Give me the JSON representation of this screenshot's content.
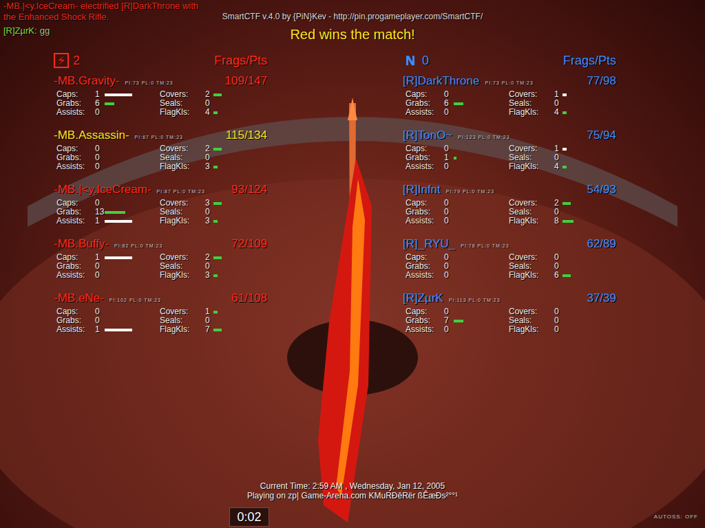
{
  "hud": {
    "killfeed": [
      "-MB.|<y.IceCream- electrified [R]DarkThrone with",
      "the Enhanced Shock Rifle."
    ],
    "chat": {
      "name": "[R]ZµrK:",
      "text": "gg"
    },
    "header": "SmartCTF v.4.0 by {PiN}Kev - http://pin.progameplayer.com/SmartCTF/",
    "banner": "Red wins the match!",
    "clock": "Current Time: 2:59 AM , Wednesday, Jan 12, 2005",
    "server": "Playing on zp| Game-Arena.com KMuRĐêRër ßÊæĐs²°°¹",
    "timer": "0:02",
    "autoss": "AUTOSS: OFF"
  },
  "stat_labels": [
    "Caps:",
    "Grabs:",
    "Assists:",
    "Covers:",
    "Seals:",
    "FlagKls:"
  ],
  "teams": [
    {
      "team": "red",
      "score": "2",
      "column_header": "Frags/Pts",
      "color": "#ff2a1e",
      "players": [
        {
          "name": "-MB.Gravity-",
          "info": "PI:73 PL:0 TM:23",
          "score": "109/147",
          "highlighted": false,
          "stats": [
            {
              "value": "1",
              "level": 1.0,
              "color": "#ffffff"
            },
            {
              "value": "6",
              "level": 0.35,
              "color": "#40d040"
            },
            {
              "value": "0",
              "level": 0,
              "color": "#ffffff"
            },
            {
              "value": "2",
              "level": 0.3,
              "color": "#40d040"
            },
            {
              "value": "0",
              "level": 0,
              "color": "#40d040"
            },
            {
              "value": "4",
              "level": 0.15,
              "color": "#40d040"
            }
          ]
        },
        {
          "name": "-MB.Assassin-",
          "info": "PI:67 PL:0 TM:23",
          "score": "115/134",
          "highlighted": true,
          "stats": [
            {
              "value": "0",
              "level": 0,
              "color": "#ffffff"
            },
            {
              "value": "0",
              "level": 0,
              "color": "#40d040"
            },
            {
              "value": "0",
              "level": 0,
              "color": "#ffffff"
            },
            {
              "value": "2",
              "level": 0.3,
              "color": "#40d040"
            },
            {
              "value": "0",
              "level": 0,
              "color": "#40d040"
            },
            {
              "value": "3",
              "level": 0.15,
              "color": "#40d040"
            }
          ]
        },
        {
          "name": "-MB.|<y.IceCream-",
          "info": "PI:87 PL:0 TM:23",
          "score": "93/124",
          "highlighted": false,
          "stats": [
            {
              "value": "0",
              "level": 0,
              "color": "#ffffff"
            },
            {
              "value": "13",
              "level": 0.75,
              "color": "#40d040"
            },
            {
              "value": "1",
              "level": 1.0,
              "color": "#ffffff"
            },
            {
              "value": "3",
              "level": 0.3,
              "color": "#40d040"
            },
            {
              "value": "0",
              "level": 0,
              "color": "#40d040"
            },
            {
              "value": "3",
              "level": 0.15,
              "color": "#40d040"
            }
          ]
        },
        {
          "name": "-MB.Buffy-",
          "info": "PI:82 PL:0 TM:23",
          "score": "72/109",
          "highlighted": false,
          "stats": [
            {
              "value": "1",
              "level": 1.0,
              "color": "#ffffff"
            },
            {
              "value": "0",
              "level": 0,
              "color": "#40d040"
            },
            {
              "value": "0",
              "level": 0,
              "color": "#ffffff"
            },
            {
              "value": "2",
              "level": 0.3,
              "color": "#40d040"
            },
            {
              "value": "0",
              "level": 0,
              "color": "#40d040"
            },
            {
              "value": "3",
              "level": 0.15,
              "color": "#40d040"
            }
          ]
        },
        {
          "name": "-MB.eNe-",
          "info": "PI:102 PL:0 TM:23",
          "score": "61/108",
          "highlighted": false,
          "stats": [
            {
              "value": "0",
              "level": 0,
              "color": "#ffffff"
            },
            {
              "value": "0",
              "level": 0,
              "color": "#40d040"
            },
            {
              "value": "1",
              "level": 1.0,
              "color": "#ffffff"
            },
            {
              "value": "1",
              "level": 0.15,
              "color": "#40d040"
            },
            {
              "value": "0",
              "level": 0,
              "color": "#40d040"
            },
            {
              "value": "7",
              "level": 0.3,
              "color": "#40d040"
            }
          ]
        }
      ]
    },
    {
      "team": "blue",
      "score": "0",
      "column_header": "Frags/Pts",
      "color": "#3a8cff",
      "players": [
        {
          "name": "[R]DarkThrone",
          "info": "PI:73 PL:0 TM:23",
          "score": "77/98",
          "highlighted": false,
          "stats": [
            {
              "value": "0",
              "level": 0,
              "color": "#ffffff"
            },
            {
              "value": "6",
              "level": 0.35,
              "color": "#40d040"
            },
            {
              "value": "0",
              "level": 0,
              "color": "#ffffff"
            },
            {
              "value": "1",
              "level": 0.15,
              "color": "#ffffff"
            },
            {
              "value": "0",
              "level": 0,
              "color": "#40d040"
            },
            {
              "value": "4",
              "level": 0.15,
              "color": "#40d040"
            }
          ]
        },
        {
          "name": "[R]TonO~",
          "info": "PI:123 PL:0 TM:23",
          "score": "75/94",
          "highlighted": false,
          "stats": [
            {
              "value": "0",
              "level": 0,
              "color": "#ffffff"
            },
            {
              "value": "1",
              "level": 0.1,
              "color": "#40d040"
            },
            {
              "value": "0",
              "level": 0,
              "color": "#ffffff"
            },
            {
              "value": "1",
              "level": 0.15,
              "color": "#ffffff"
            },
            {
              "value": "0",
              "level": 0,
              "color": "#40d040"
            },
            {
              "value": "4",
              "level": 0.15,
              "color": "#40d040"
            }
          ]
        },
        {
          "name": "[R]Infnt",
          "info": "PI:79 PL:0 TM:23",
          "score": "54/93",
          "highlighted": false,
          "stats": [
            {
              "value": "0",
              "level": 0,
              "color": "#ffffff"
            },
            {
              "value": "0",
              "level": 0,
              "color": "#40d040"
            },
            {
              "value": "0",
              "level": 0,
              "color": "#ffffff"
            },
            {
              "value": "2",
              "level": 0.3,
              "color": "#40d040"
            },
            {
              "value": "0",
              "level": 0,
              "color": "#40d040"
            },
            {
              "value": "8",
              "level": 0.4,
              "color": "#40d040"
            }
          ]
        },
        {
          "name": "[R]_RYU_",
          "info": "PI:78 PL:0 TM:23",
          "score": "62/89",
          "highlighted": false,
          "stats": [
            {
              "value": "0",
              "level": 0,
              "color": "#ffffff"
            },
            {
              "value": "0",
              "level": 0,
              "color": "#40d040"
            },
            {
              "value": "0",
              "level": 0,
              "color": "#ffffff"
            },
            {
              "value": "0",
              "level": 0,
              "color": "#40d040"
            },
            {
              "value": "0",
              "level": 0,
              "color": "#40d040"
            },
            {
              "value": "6",
              "level": 0.3,
              "color": "#40d040"
            }
          ]
        },
        {
          "name": "[R]ZµrK",
          "info": "PI:113 PL:0 TM:23",
          "score": "37/39",
          "highlighted": false,
          "stats": [
            {
              "value": "0",
              "level": 0,
              "color": "#ffffff"
            },
            {
              "value": "7",
              "level": 0.35,
              "color": "#40d040"
            },
            {
              "value": "0",
              "level": 0,
              "color": "#ffffff"
            },
            {
              "value": "0",
              "level": 0,
              "color": "#40d040"
            },
            {
              "value": "0",
              "level": 0,
              "color": "#40d040"
            },
            {
              "value": "0",
              "level": 0,
              "color": "#40d040"
            }
          ]
        }
      ]
    }
  ]
}
